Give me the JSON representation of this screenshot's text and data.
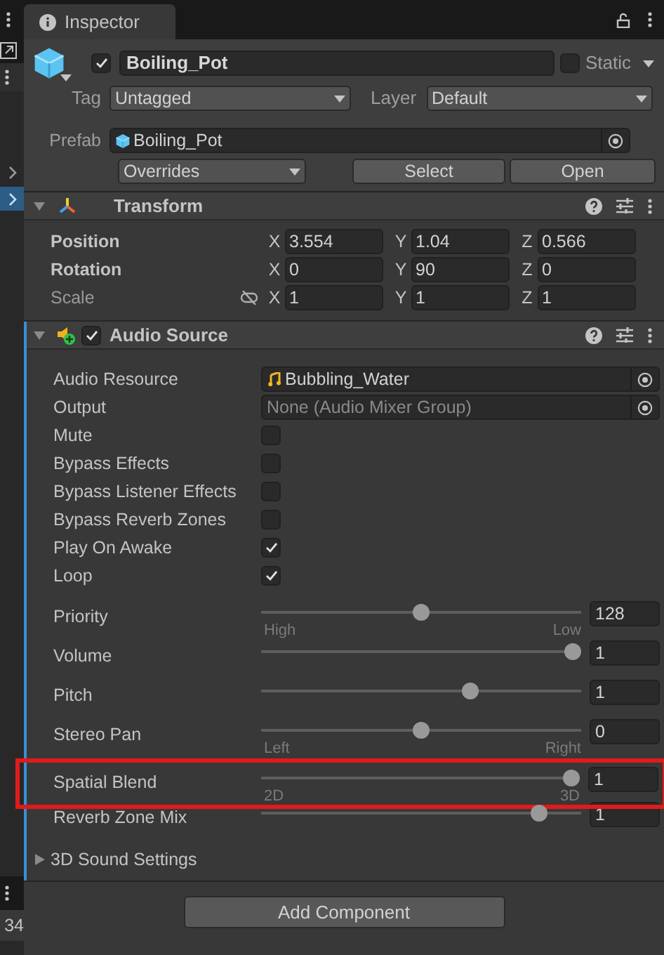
{
  "left_strip": {
    "count": "34"
  },
  "tab": {
    "title": "Inspector"
  },
  "object": {
    "active": true,
    "name": "Boiling_Pot",
    "static_label": "Static",
    "static": false,
    "tag_label": "Tag",
    "tag": "Untagged",
    "layer_label": "Layer",
    "layer": "Default",
    "prefab_label": "Prefab",
    "prefab": "Boiling_Pot",
    "overrides": "Overrides",
    "buttons": [
      "Select",
      "Open"
    ]
  },
  "transform": {
    "title": "Transform",
    "rows": [
      {
        "kind": "vector",
        "label": "Position",
        "modified": true,
        "fields": [
          {
            "axis": "X",
            "value": "3.554"
          },
          {
            "axis": "Y",
            "value": "1.04"
          },
          {
            "axis": "Z",
            "value": "0.566"
          }
        ]
      },
      {
        "kind": "vector",
        "label": "Rotation",
        "modified": true,
        "fields": [
          {
            "axis": "X",
            "value": "0"
          },
          {
            "axis": "Y",
            "value": "90"
          },
          {
            "axis": "Z",
            "value": "0"
          }
        ]
      },
      {
        "kind": "scale",
        "label": "Scale",
        "modified": false,
        "fields": [
          {
            "axis": "X",
            "value": "1"
          },
          {
            "axis": "Y",
            "value": "1"
          },
          {
            "axis": "Z",
            "value": "1"
          }
        ]
      }
    ]
  },
  "audio_source": {
    "title": "Audio Source",
    "enabled": true,
    "properties": [
      {
        "kind": "object",
        "label": "Audio Resource",
        "value": "Bubbling_Water"
      },
      {
        "kind": "object",
        "label": "Output",
        "placeholder": "None (Audio Mixer Group)"
      },
      {
        "kind": "checkbox",
        "label": "Mute",
        "checked": false
      },
      {
        "kind": "checkbox",
        "label": "Bypass Effects",
        "checked": false
      },
      {
        "kind": "checkbox",
        "label": "Bypass Listener Effects",
        "checked": false
      },
      {
        "kind": "checkbox",
        "label": "Bypass Reverb Zones",
        "checked": false
      },
      {
        "kind": "checkbox",
        "label": "Play On Awake",
        "checked": true
      },
      {
        "kind": "checkbox",
        "label": "Loop",
        "checked": true
      },
      {
        "kind": "slider",
        "label": "Priority",
        "level": 0.5,
        "value": "128",
        "min_label": "High",
        "max_label": "Low",
        "highlighted": false
      },
      {
        "kind": "slider",
        "label": "Volume",
        "level": 1,
        "value": "1",
        "highlighted": false
      },
      {
        "kind": "slider",
        "label": "Pitch",
        "level": 0.66,
        "value": "1",
        "highlighted": false
      },
      {
        "kind": "slider",
        "label": "Stereo Pan",
        "level": 0.5,
        "value": "0",
        "min_label": "Left",
        "max_label": "Right",
        "highlighted": false
      },
      {
        "kind": "slider",
        "label": "Spatial Blend",
        "level": 1,
        "value": "1",
        "min_label": "2D",
        "max_label": "3D",
        "highlighted": true
      },
      {
        "kind": "slider",
        "label": "Reverb Zone Mix",
        "level": 0.89,
        "value": "1",
        "highlighted": false
      }
    ],
    "foldout": {
      "label": "3D Sound Settings",
      "expanded": false
    }
  },
  "add_component": "Add Component"
}
